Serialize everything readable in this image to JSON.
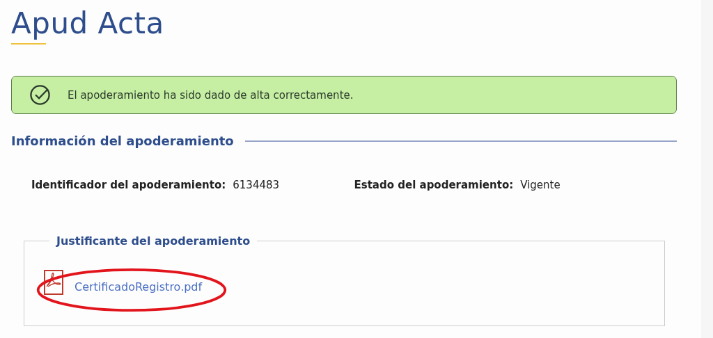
{
  "page": {
    "title": "Apud Acta"
  },
  "alert": {
    "kind": "success",
    "message": "El apoderamiento ha sido dado de alta correctamente."
  },
  "section": {
    "title": "Información del apoderamiento"
  },
  "fields": [
    {
      "label": "Identificador del apoderamiento:",
      "value": "6134483"
    },
    {
      "label": "Estado del apoderamiento:",
      "value": "Vigente"
    }
  ],
  "attachment": {
    "legend": "Justificante del apoderamiento",
    "file": "CertificadoRegistro.pdf",
    "circled": true
  }
}
